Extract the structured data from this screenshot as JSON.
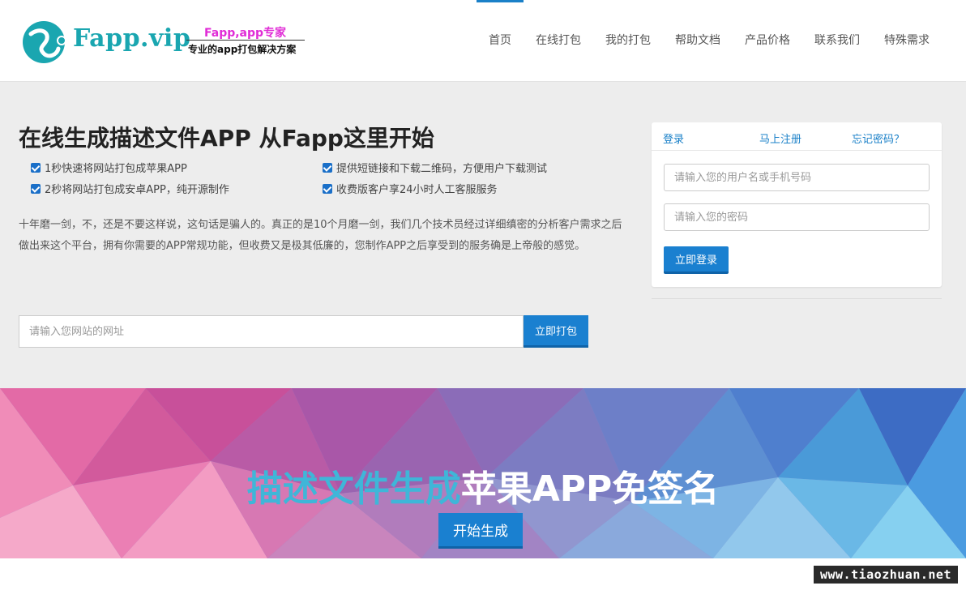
{
  "logo": {
    "name": "Fapp.vip",
    "tagline_top": "Fapp,app专家",
    "tagline_bottom": "专业的app打包解决方案"
  },
  "nav": {
    "items": [
      "首页",
      "在线打包",
      "我的打包",
      "帮助文档",
      "产品价格",
      "联系我们",
      "特殊需求"
    ],
    "active": "首页"
  },
  "hero": {
    "title": "在线生成描述文件APP 从Fapp这里开始",
    "features": [
      "1秒快速将网站打包成苹果APP",
      "提供短链接和下载二维码，方便用户下载测试",
      "2秒将网站打包成安卓APP，纯开源制作",
      "收费版客户享24小时人工客服服务"
    ],
    "description": "十年磨一剑，不，还是不要这样说，这句话是骗人的。真正的是10个月磨一剑，我们几个技术员经过详细缜密的分析客户需求之后做出来这个平台，拥有你需要的APP常规功能，但收费又是极其低廉的，您制作APP之后享受到的服务确是上帝般的感觉。",
    "url_placeholder": "请输入您网站的网址",
    "pack_button": "立即打包"
  },
  "login": {
    "tabs": [
      "登录",
      "马上注册",
      "忘记密码？"
    ],
    "username_placeholder": "请输入您的用户名或手机号码",
    "password_placeholder": "请输入您的密码",
    "submit": "立即登录"
  },
  "banner": {
    "title_highlight": "描述文件生成",
    "title_rest": "苹果APP免签名",
    "button": "开始生成"
  },
  "watermark": "www.tiaozhuan.net",
  "colors": {
    "accent": "#1a80d0",
    "logo": "#1aa6b0",
    "tagline": "#e02bd6",
    "banner_highlight": "#3fb6d8"
  }
}
